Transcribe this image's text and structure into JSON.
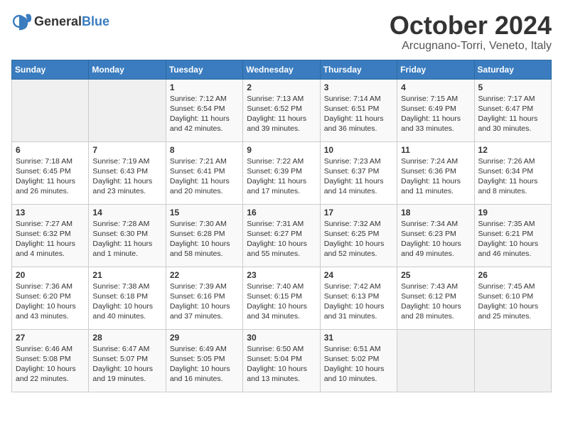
{
  "logo": {
    "text_general": "General",
    "text_blue": "Blue"
  },
  "header": {
    "month_year": "October 2024",
    "location": "Arcugnano-Torri, Veneto, Italy"
  },
  "days_of_week": [
    "Sunday",
    "Monday",
    "Tuesday",
    "Wednesday",
    "Thursday",
    "Friday",
    "Saturday"
  ],
  "weeks": [
    [
      {
        "day": "",
        "sunrise": "",
        "sunset": "",
        "daylight": ""
      },
      {
        "day": "",
        "sunrise": "",
        "sunset": "",
        "daylight": ""
      },
      {
        "day": "1",
        "sunrise": "Sunrise: 7:12 AM",
        "sunset": "Sunset: 6:54 PM",
        "daylight": "Daylight: 11 hours and 42 minutes."
      },
      {
        "day": "2",
        "sunrise": "Sunrise: 7:13 AM",
        "sunset": "Sunset: 6:52 PM",
        "daylight": "Daylight: 11 hours and 39 minutes."
      },
      {
        "day": "3",
        "sunrise": "Sunrise: 7:14 AM",
        "sunset": "Sunset: 6:51 PM",
        "daylight": "Daylight: 11 hours and 36 minutes."
      },
      {
        "day": "4",
        "sunrise": "Sunrise: 7:15 AM",
        "sunset": "Sunset: 6:49 PM",
        "daylight": "Daylight: 11 hours and 33 minutes."
      },
      {
        "day": "5",
        "sunrise": "Sunrise: 7:17 AM",
        "sunset": "Sunset: 6:47 PM",
        "daylight": "Daylight: 11 hours and 30 minutes."
      }
    ],
    [
      {
        "day": "6",
        "sunrise": "Sunrise: 7:18 AM",
        "sunset": "Sunset: 6:45 PM",
        "daylight": "Daylight: 11 hours and 26 minutes."
      },
      {
        "day": "7",
        "sunrise": "Sunrise: 7:19 AM",
        "sunset": "Sunset: 6:43 PM",
        "daylight": "Daylight: 11 hours and 23 minutes."
      },
      {
        "day": "8",
        "sunrise": "Sunrise: 7:21 AM",
        "sunset": "Sunset: 6:41 PM",
        "daylight": "Daylight: 11 hours and 20 minutes."
      },
      {
        "day": "9",
        "sunrise": "Sunrise: 7:22 AM",
        "sunset": "Sunset: 6:39 PM",
        "daylight": "Daylight: 11 hours and 17 minutes."
      },
      {
        "day": "10",
        "sunrise": "Sunrise: 7:23 AM",
        "sunset": "Sunset: 6:37 PM",
        "daylight": "Daylight: 11 hours and 14 minutes."
      },
      {
        "day": "11",
        "sunrise": "Sunrise: 7:24 AM",
        "sunset": "Sunset: 6:36 PM",
        "daylight": "Daylight: 11 hours and 11 minutes."
      },
      {
        "day": "12",
        "sunrise": "Sunrise: 7:26 AM",
        "sunset": "Sunset: 6:34 PM",
        "daylight": "Daylight: 11 hours and 8 minutes."
      }
    ],
    [
      {
        "day": "13",
        "sunrise": "Sunrise: 7:27 AM",
        "sunset": "Sunset: 6:32 PM",
        "daylight": "Daylight: 11 hours and 4 minutes."
      },
      {
        "day": "14",
        "sunrise": "Sunrise: 7:28 AM",
        "sunset": "Sunset: 6:30 PM",
        "daylight": "Daylight: 11 hours and 1 minute."
      },
      {
        "day": "15",
        "sunrise": "Sunrise: 7:30 AM",
        "sunset": "Sunset: 6:28 PM",
        "daylight": "Daylight: 10 hours and 58 minutes."
      },
      {
        "day": "16",
        "sunrise": "Sunrise: 7:31 AM",
        "sunset": "Sunset: 6:27 PM",
        "daylight": "Daylight: 10 hours and 55 minutes."
      },
      {
        "day": "17",
        "sunrise": "Sunrise: 7:32 AM",
        "sunset": "Sunset: 6:25 PM",
        "daylight": "Daylight: 10 hours and 52 minutes."
      },
      {
        "day": "18",
        "sunrise": "Sunrise: 7:34 AM",
        "sunset": "Sunset: 6:23 PM",
        "daylight": "Daylight: 10 hours and 49 minutes."
      },
      {
        "day": "19",
        "sunrise": "Sunrise: 7:35 AM",
        "sunset": "Sunset: 6:21 PM",
        "daylight": "Daylight: 10 hours and 46 minutes."
      }
    ],
    [
      {
        "day": "20",
        "sunrise": "Sunrise: 7:36 AM",
        "sunset": "Sunset: 6:20 PM",
        "daylight": "Daylight: 10 hours and 43 minutes."
      },
      {
        "day": "21",
        "sunrise": "Sunrise: 7:38 AM",
        "sunset": "Sunset: 6:18 PM",
        "daylight": "Daylight: 10 hours and 40 minutes."
      },
      {
        "day": "22",
        "sunrise": "Sunrise: 7:39 AM",
        "sunset": "Sunset: 6:16 PM",
        "daylight": "Daylight: 10 hours and 37 minutes."
      },
      {
        "day": "23",
        "sunrise": "Sunrise: 7:40 AM",
        "sunset": "Sunset: 6:15 PM",
        "daylight": "Daylight: 10 hours and 34 minutes."
      },
      {
        "day": "24",
        "sunrise": "Sunrise: 7:42 AM",
        "sunset": "Sunset: 6:13 PM",
        "daylight": "Daylight: 10 hours and 31 minutes."
      },
      {
        "day": "25",
        "sunrise": "Sunrise: 7:43 AM",
        "sunset": "Sunset: 6:12 PM",
        "daylight": "Daylight: 10 hours and 28 minutes."
      },
      {
        "day": "26",
        "sunrise": "Sunrise: 7:45 AM",
        "sunset": "Sunset: 6:10 PM",
        "daylight": "Daylight: 10 hours and 25 minutes."
      }
    ],
    [
      {
        "day": "27",
        "sunrise": "Sunrise: 6:46 AM",
        "sunset": "Sunset: 5:08 PM",
        "daylight": "Daylight: 10 hours and 22 minutes."
      },
      {
        "day": "28",
        "sunrise": "Sunrise: 6:47 AM",
        "sunset": "Sunset: 5:07 PM",
        "daylight": "Daylight: 10 hours and 19 minutes."
      },
      {
        "day": "29",
        "sunrise": "Sunrise: 6:49 AM",
        "sunset": "Sunset: 5:05 PM",
        "daylight": "Daylight: 10 hours and 16 minutes."
      },
      {
        "day": "30",
        "sunrise": "Sunrise: 6:50 AM",
        "sunset": "Sunset: 5:04 PM",
        "daylight": "Daylight: 10 hours and 13 minutes."
      },
      {
        "day": "31",
        "sunrise": "Sunrise: 6:51 AM",
        "sunset": "Sunset: 5:02 PM",
        "daylight": "Daylight: 10 hours and 10 minutes."
      },
      {
        "day": "",
        "sunrise": "",
        "sunset": "",
        "daylight": ""
      },
      {
        "day": "",
        "sunrise": "",
        "sunset": "",
        "daylight": ""
      }
    ]
  ]
}
